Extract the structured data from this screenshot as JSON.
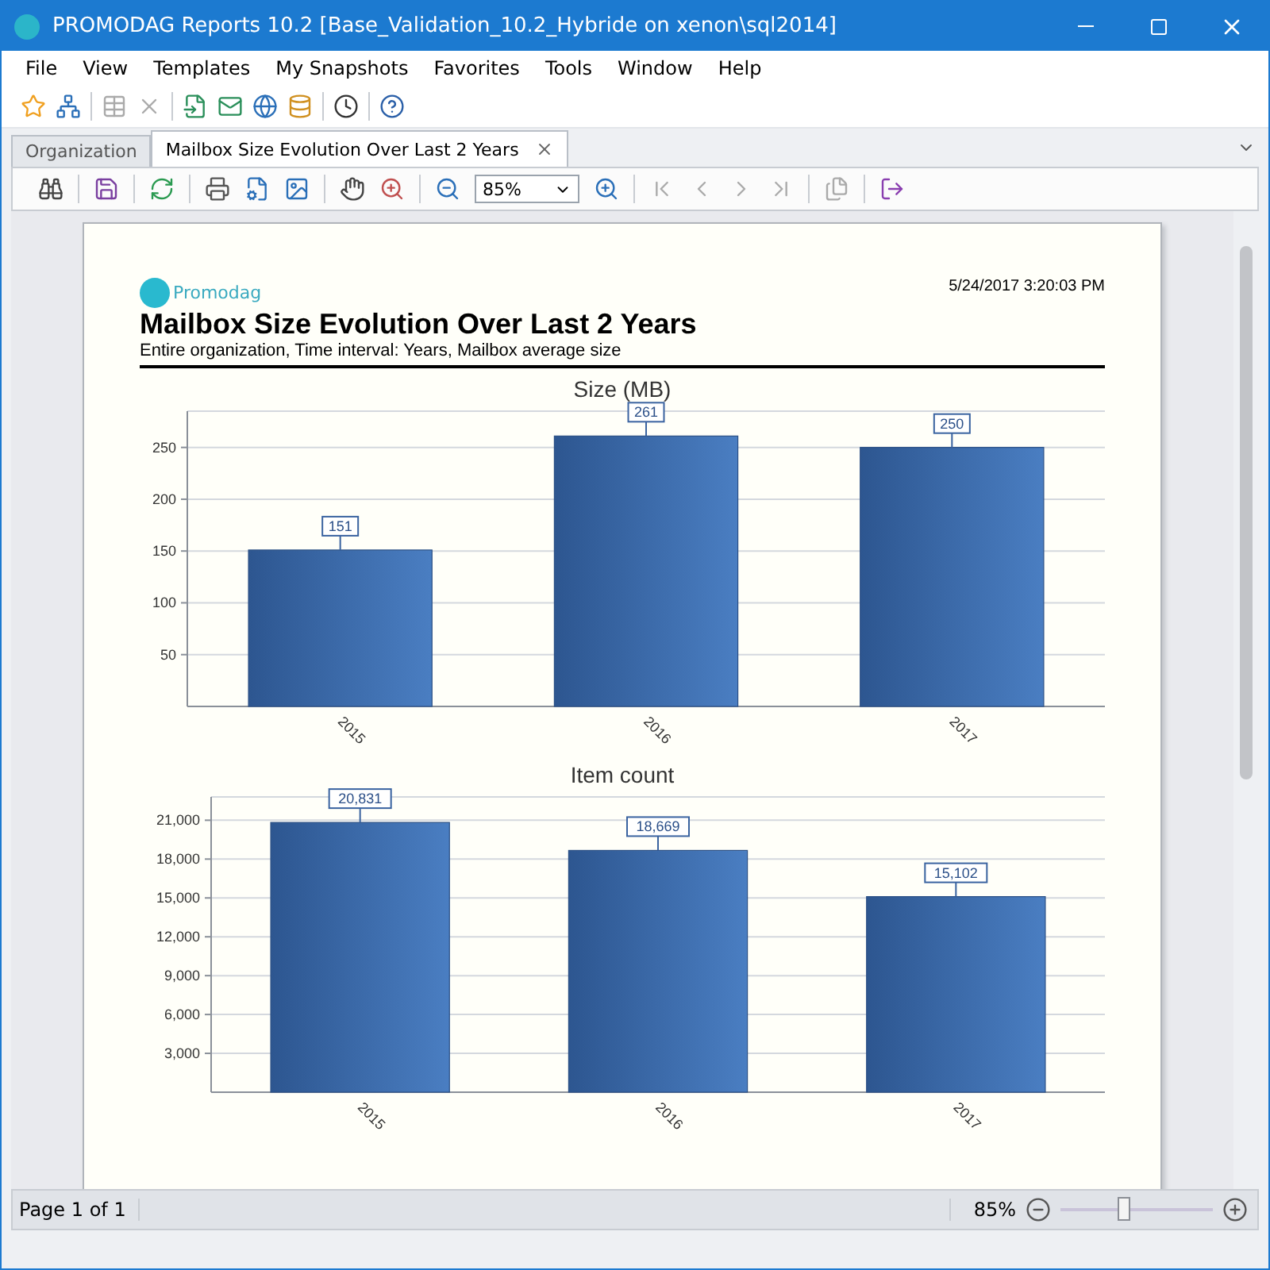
{
  "window": {
    "title": "PROMODAG Reports 10.2 [Base_Validation_10.2_Hybride on xenon\\sql2014]"
  },
  "menu": [
    "File",
    "View",
    "Templates",
    "My Snapshots",
    "Favorites",
    "Tools",
    "Window",
    "Help"
  ],
  "tabs": [
    {
      "label": "Organization",
      "selected": false
    },
    {
      "label": "Mailbox Size Evolution Over Last 2 Years",
      "selected": true
    }
  ],
  "report_toolbar": {
    "zoom": "85%"
  },
  "report": {
    "brand": "Promodag",
    "timestamp": "5/24/2017 3:20:03 PM",
    "title": "Mailbox Size Evolution Over Last 2 Years",
    "subtitle": "Entire organization, Time interval: Years, Mailbox average size",
    "charts": [
      {
        "chart_data": {
          "type": "bar",
          "title": "Size (MB)",
          "categories": [
            "2015",
            "2016",
            "2017"
          ],
          "series": [
            {
              "values": [
                151,
                261,
                250
              ]
            }
          ],
          "grid": true,
          "ylim": [
            0,
            285
          ],
          "yticks": [
            50,
            100,
            150,
            200,
            250
          ],
          "data_labels": true
        }
      },
      {
        "chart_data": {
          "type": "bar",
          "title": "Item count",
          "categories": [
            "2015",
            "2016",
            "2017"
          ],
          "series": [
            {
              "values": [
                20831,
                18669,
                15102
              ]
            }
          ],
          "grid": true,
          "ylim": [
            0,
            22800
          ],
          "yticks": [
            {
              "value": 3000,
              "label": "3,000"
            },
            {
              "value": 6000,
              "label": "6,000"
            },
            {
              "value": 9000,
              "label": "9,000"
            },
            {
              "value": 12000,
              "label": "12,000"
            },
            {
              "value": 15000,
              "label": "15,000"
            },
            {
              "value": 18000,
              "label": "18,000"
            },
            {
              "value": 21000,
              "label": "21,000"
            }
          ],
          "value_labels": [
            "20,831",
            "18,669",
            "15,102"
          ]
        }
      }
    ]
  },
  "status_bar": {
    "page": "Page 1 of 1",
    "zoom": "85%",
    "zoom_slider": {
      "level": 0.42
    }
  }
}
